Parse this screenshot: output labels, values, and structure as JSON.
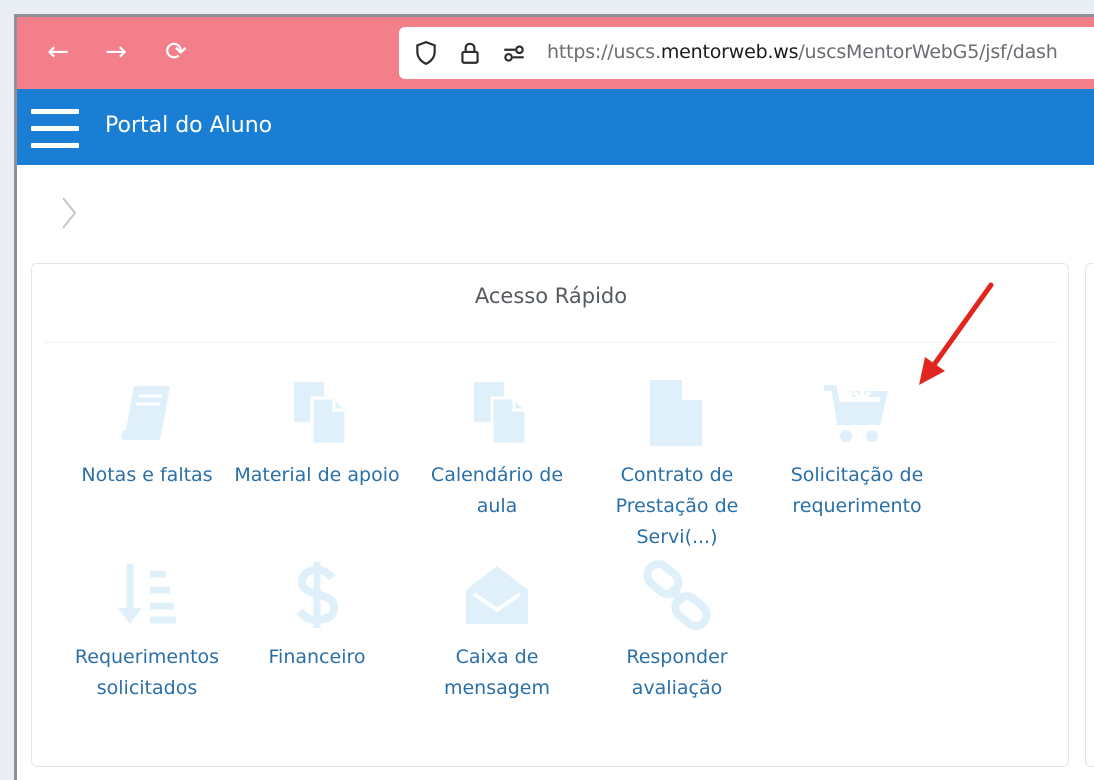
{
  "browser": {
    "back_glyph": "←",
    "forward_glyph": "→",
    "reload_glyph": "⟳",
    "url_prefix": "https://uscs.",
    "url_host": "mentorweb.ws",
    "url_path": "/uscsMentorWebG5/jsf/dash",
    "icons": [
      "back-arrow-icon",
      "forward-arrow-icon",
      "reload-icon",
      "shield-icon",
      "lock-icon",
      "site-permissions-icon"
    ]
  },
  "app": {
    "title": "Portal do Aluno",
    "header_color": "#1a7fd4",
    "icon_color": "#dff0fb",
    "label_color": "#2b6fa8"
  },
  "quick_access": {
    "title": "Acesso Rápido",
    "items": [
      {
        "label": "Notas e faltas",
        "icon": "book-icon"
      },
      {
        "label": "Material de apoio",
        "icon": "documents-icon"
      },
      {
        "label": "Calendário de aula",
        "icon": "documents-icon"
      },
      {
        "label": "Contrato de Prestação de Servi(...)",
        "icon": "file-icon"
      },
      {
        "label": "Solicitação de requerimento",
        "icon": "cart-download-icon"
      },
      {
        "label": "Requerimentos solicitados",
        "icon": "sort-list-icon"
      },
      {
        "label": "Financeiro",
        "icon": "dollar-icon"
      },
      {
        "label": "Caixa de mensagem",
        "icon": "envelope-open-icon"
      },
      {
        "label": "Responder avaliação",
        "icon": "link-icon"
      }
    ]
  }
}
